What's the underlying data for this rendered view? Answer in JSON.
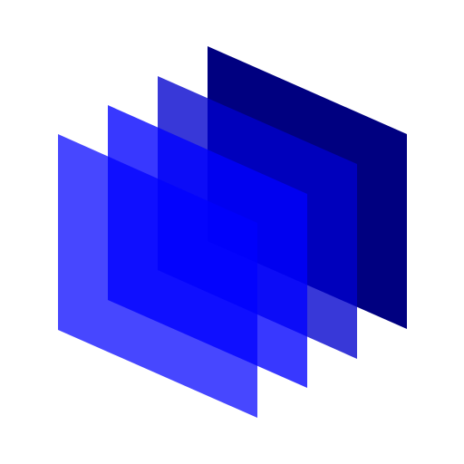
{
  "icon": "stacked-layers-icon",
  "background_color": "#FFFFFF",
  "layers": [
    {
      "name": "back",
      "color": "#000080",
      "opacity": 1.0
    },
    {
      "name": "middle-back",
      "color": "#0000CD",
      "opacity": 0.78
    },
    {
      "name": "middle-front",
      "color": "#0000FF",
      "opacity": 0.78
    },
    {
      "name": "front",
      "color": "#0000FF",
      "opacity": 0.72
    }
  ]
}
